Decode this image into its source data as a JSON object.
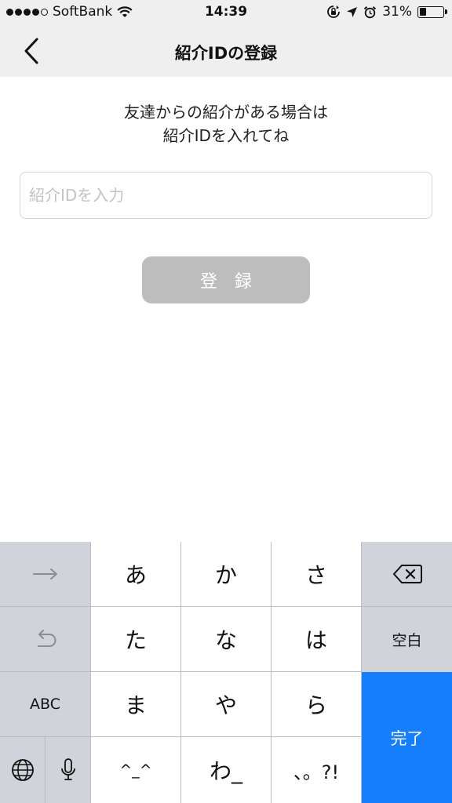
{
  "status_bar": {
    "carrier": "SoftBank",
    "time": "14:39",
    "battery_percent": "31%",
    "battery_level": 0.31,
    "signal_bars_filled": 4,
    "signal_bars_total": 5
  },
  "nav": {
    "title": "紹介IDの登録"
  },
  "content": {
    "intro_line1": "友達からの紹介がある場合は",
    "intro_line2": "紹介IDを入れてね",
    "input_placeholder": "紹介IDを入力",
    "input_value": "",
    "register_label": "登録"
  },
  "keyboard": {
    "row1": [
      "あ",
      "か",
      "さ"
    ],
    "row2": [
      "た",
      "な",
      "は"
    ],
    "row3": [
      "ま",
      "や",
      "ら"
    ],
    "row4": [
      "^_^",
      "わ_",
      "、。?!"
    ],
    "abc_label": "ABC",
    "space_label": "空白",
    "done_label": "完了"
  },
  "colors": {
    "done_key": "#147efb",
    "register_button_disabled": "#bdbdbd"
  }
}
